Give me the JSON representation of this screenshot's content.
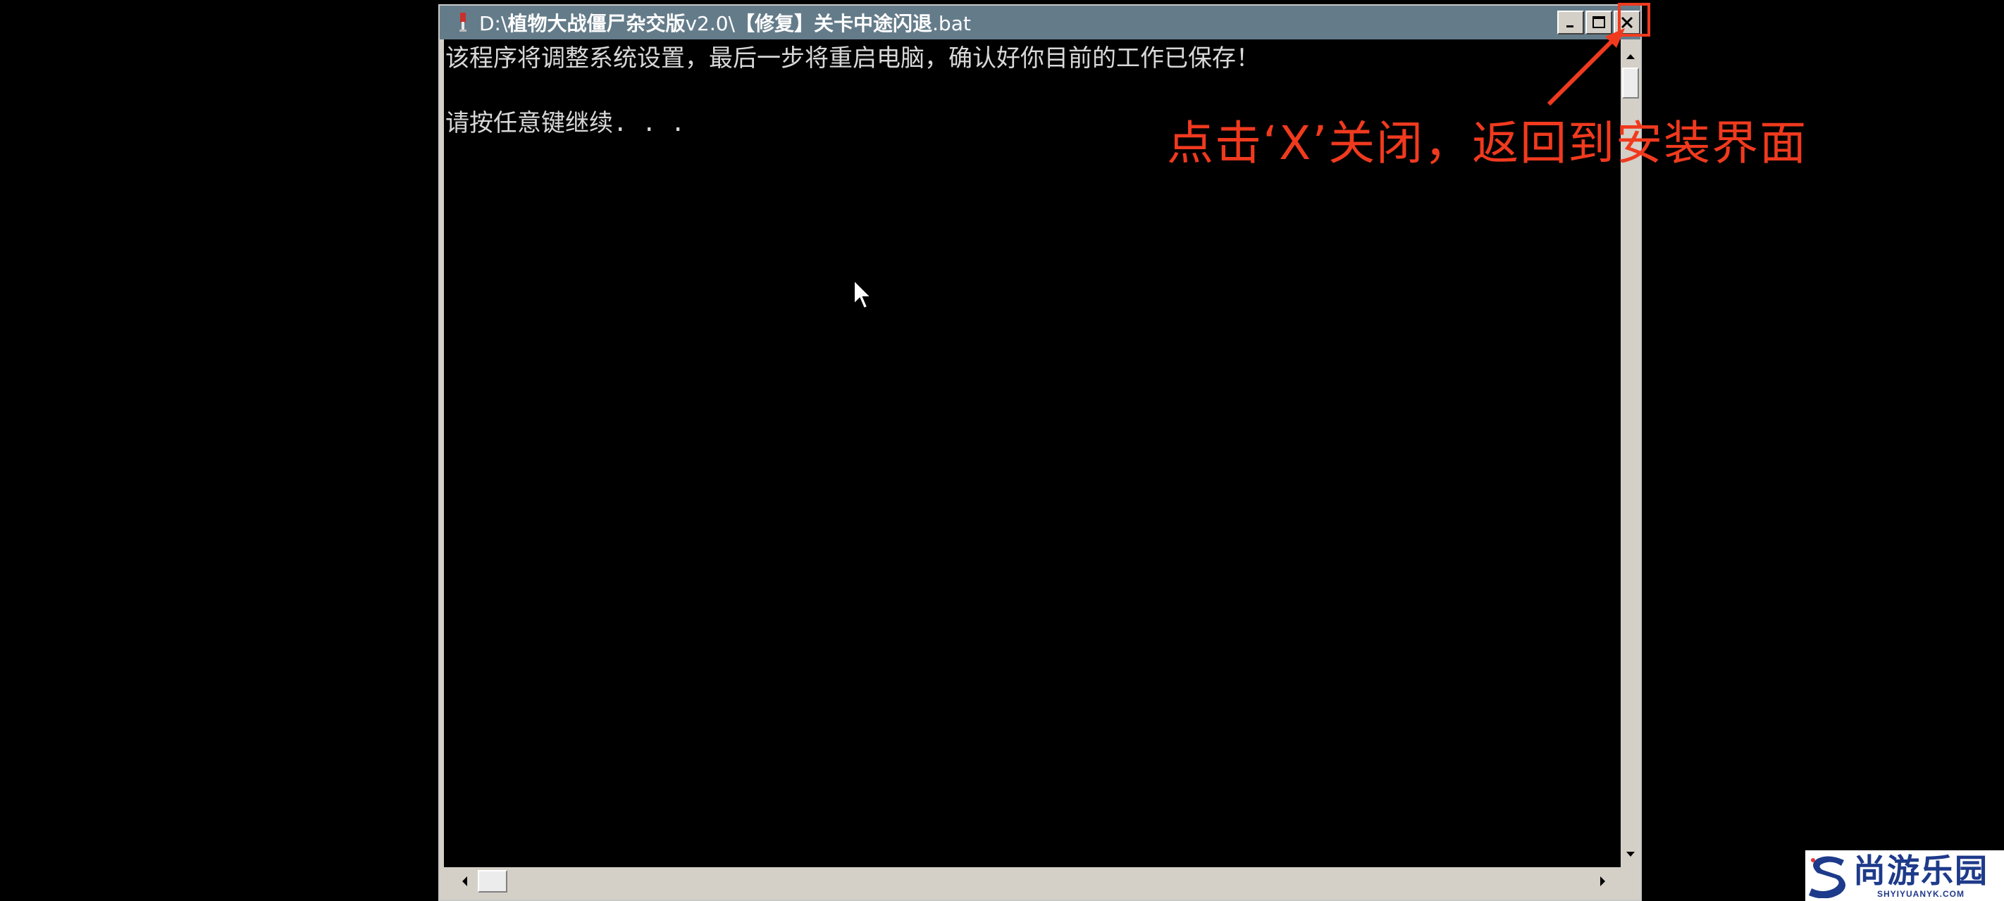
{
  "window": {
    "title_prefix": "D:\\",
    "title_game": "植物大战僵尸杂交版",
    "title_version": "v2.0\\",
    "title_file": "【修复】关卡中途闪退",
    "title_ext": ".bat",
    "icon": "batch-file-icon"
  },
  "console": {
    "lines": [
      "该程序将调整系统设置，最后一步将重启电脑，确认好你目前的工作已保存！",
      "",
      "请按任意键继续. . ."
    ]
  },
  "annotation": {
    "text": "点击‘X’关闭，返回到安装界面",
    "color": "#f03a1e"
  },
  "watermark": {
    "name_cn": "尚游乐园",
    "name_en": "SHYIYUANYK.COM"
  },
  "colors": {
    "titlebar": "#647c8a",
    "console_bg": "#000000",
    "console_text": "#d8d8d8",
    "logo_blue": "#1e3a8a"
  }
}
